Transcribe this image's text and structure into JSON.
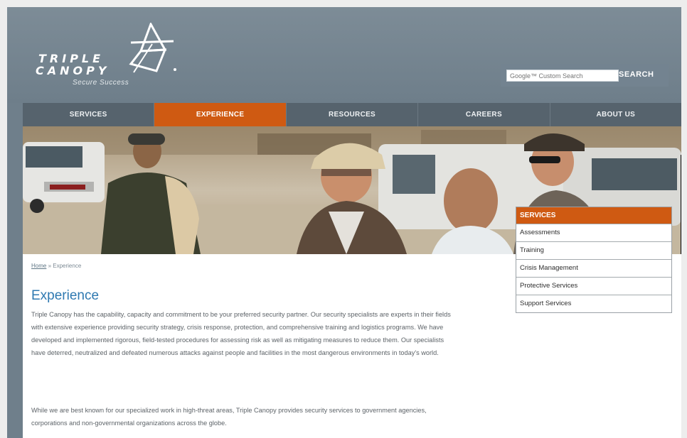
{
  "header": {
    "logo": {
      "line1": "TRIPLE",
      "line2": "CANOPY",
      "tagline": "Secure Success"
    },
    "search": {
      "placeholder": "Google™ Custom Search",
      "button_label": "SEARCH"
    }
  },
  "nav": {
    "items": [
      {
        "label": "SERVICES"
      },
      {
        "label": "EXPERIENCE"
      },
      {
        "label": "RESOURCES"
      },
      {
        "label": "CAREERS"
      },
      {
        "label": "ABOUT US"
      }
    ],
    "active_index": 1
  },
  "sidebar": {
    "heading": "SERVICES",
    "items": [
      {
        "label": "Assessments"
      },
      {
        "label": "Training"
      },
      {
        "label": "Crisis Management"
      },
      {
        "label": "Protective Services"
      },
      {
        "label": "Support Services"
      }
    ]
  },
  "breadcrumb": {
    "home": "Home",
    "separator": " » ",
    "current": "Experience"
  },
  "main": {
    "title": "Experience",
    "paragraph1": "Triple Canopy has the capability, capacity and commitment to be your preferred security partner. Our security specialists are experts in their fields with extensive experience providing security strategy, crisis response, protection, and comprehensive training and logistics programs. We have developed and implemented rigorous, field-tested procedures for assessing risk as well as mitigating measures to reduce them. Our specialists have deterred, neutralized and defeated numerous attacks against people and facilities in the most dangerous environments in today's world.",
    "paragraph2": "While we are best known for our specialized work in high-threat areas, Triple Canopy provides security services to government agencies, corporations and non-governmental organizations across the globe."
  },
  "colors": {
    "accent": "#cf5a12",
    "header_bg": "#6f7f8b",
    "title": "#2f79b1"
  }
}
